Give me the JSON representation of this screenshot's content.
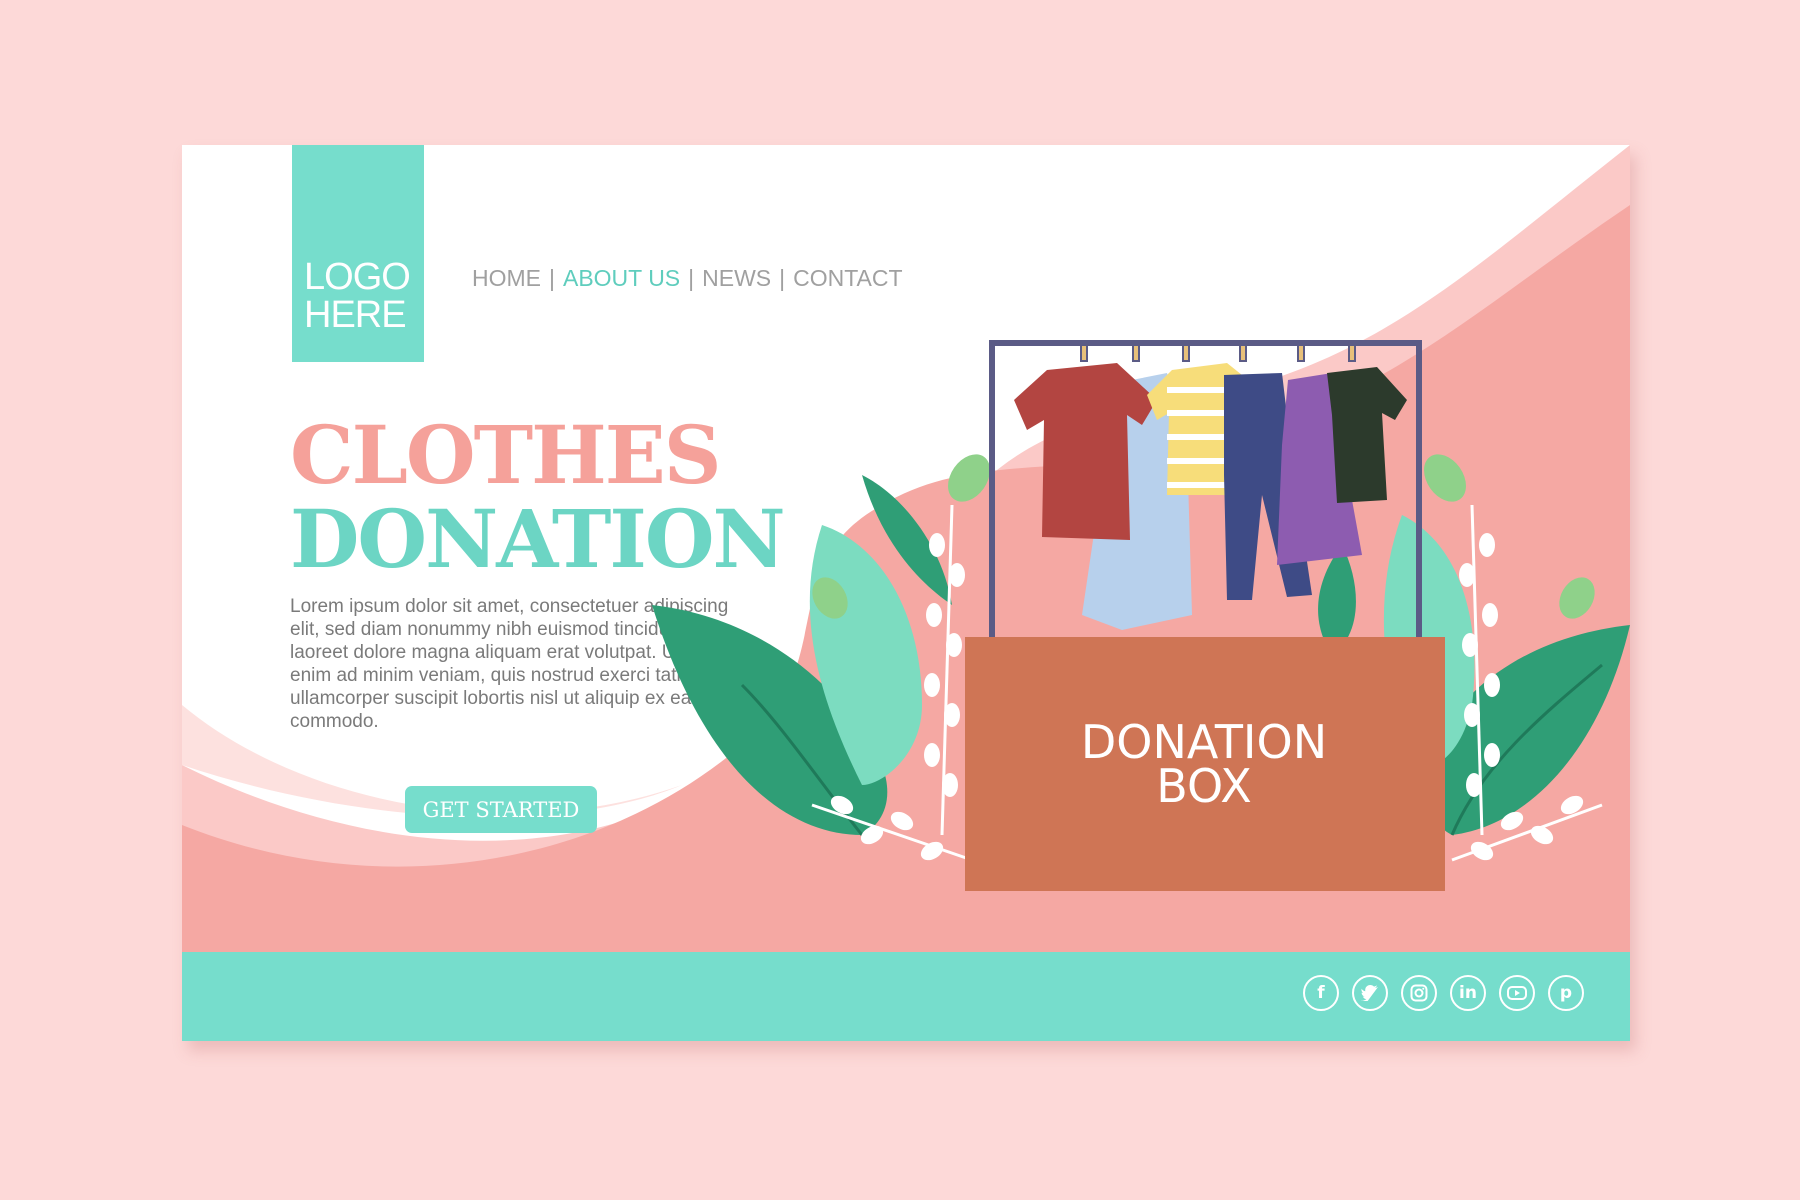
{
  "logo": {
    "line1": "LOGO",
    "line2": "HERE"
  },
  "nav": {
    "items": [
      {
        "label": "HOME"
      },
      {
        "label": "ABOUT US"
      },
      {
        "label": "NEWS"
      },
      {
        "label": "CONTACT"
      }
    ],
    "active": "ABOUT US"
  },
  "hero": {
    "title_line1": "CLOTHES",
    "title_line2": "DONATION",
    "body": "Lorem ipsum dolor sit amet, consectetuer adipiscing elit, sed diam nonummy nibh euismod tincidunt ut laoreet dolore magna aliquam erat volutpat. Ut wisi enim ad minim veniam, quis nostrud exerci tation ullamcorper suscipit lobortis nisl ut aliquip ex ea commodo.",
    "cta_label": "GET STARTED"
  },
  "donation_box": {
    "line1": "DONATION",
    "line2": "BOX"
  },
  "social": [
    {
      "name": "facebook-icon",
      "glyph": "f"
    },
    {
      "name": "twitter-icon",
      "glyph": ""
    },
    {
      "name": "instagram-icon",
      "glyph": ""
    },
    {
      "name": "linkedin-icon",
      "glyph": "in"
    },
    {
      "name": "youtube-icon",
      "glyph": ""
    },
    {
      "name": "pinterest-icon",
      "glyph": "p"
    }
  ],
  "colors": {
    "page_bg": "#fdd9d8",
    "mint": "#76ddcc",
    "pink": "#f5a19a",
    "box": "#cf7555"
  }
}
